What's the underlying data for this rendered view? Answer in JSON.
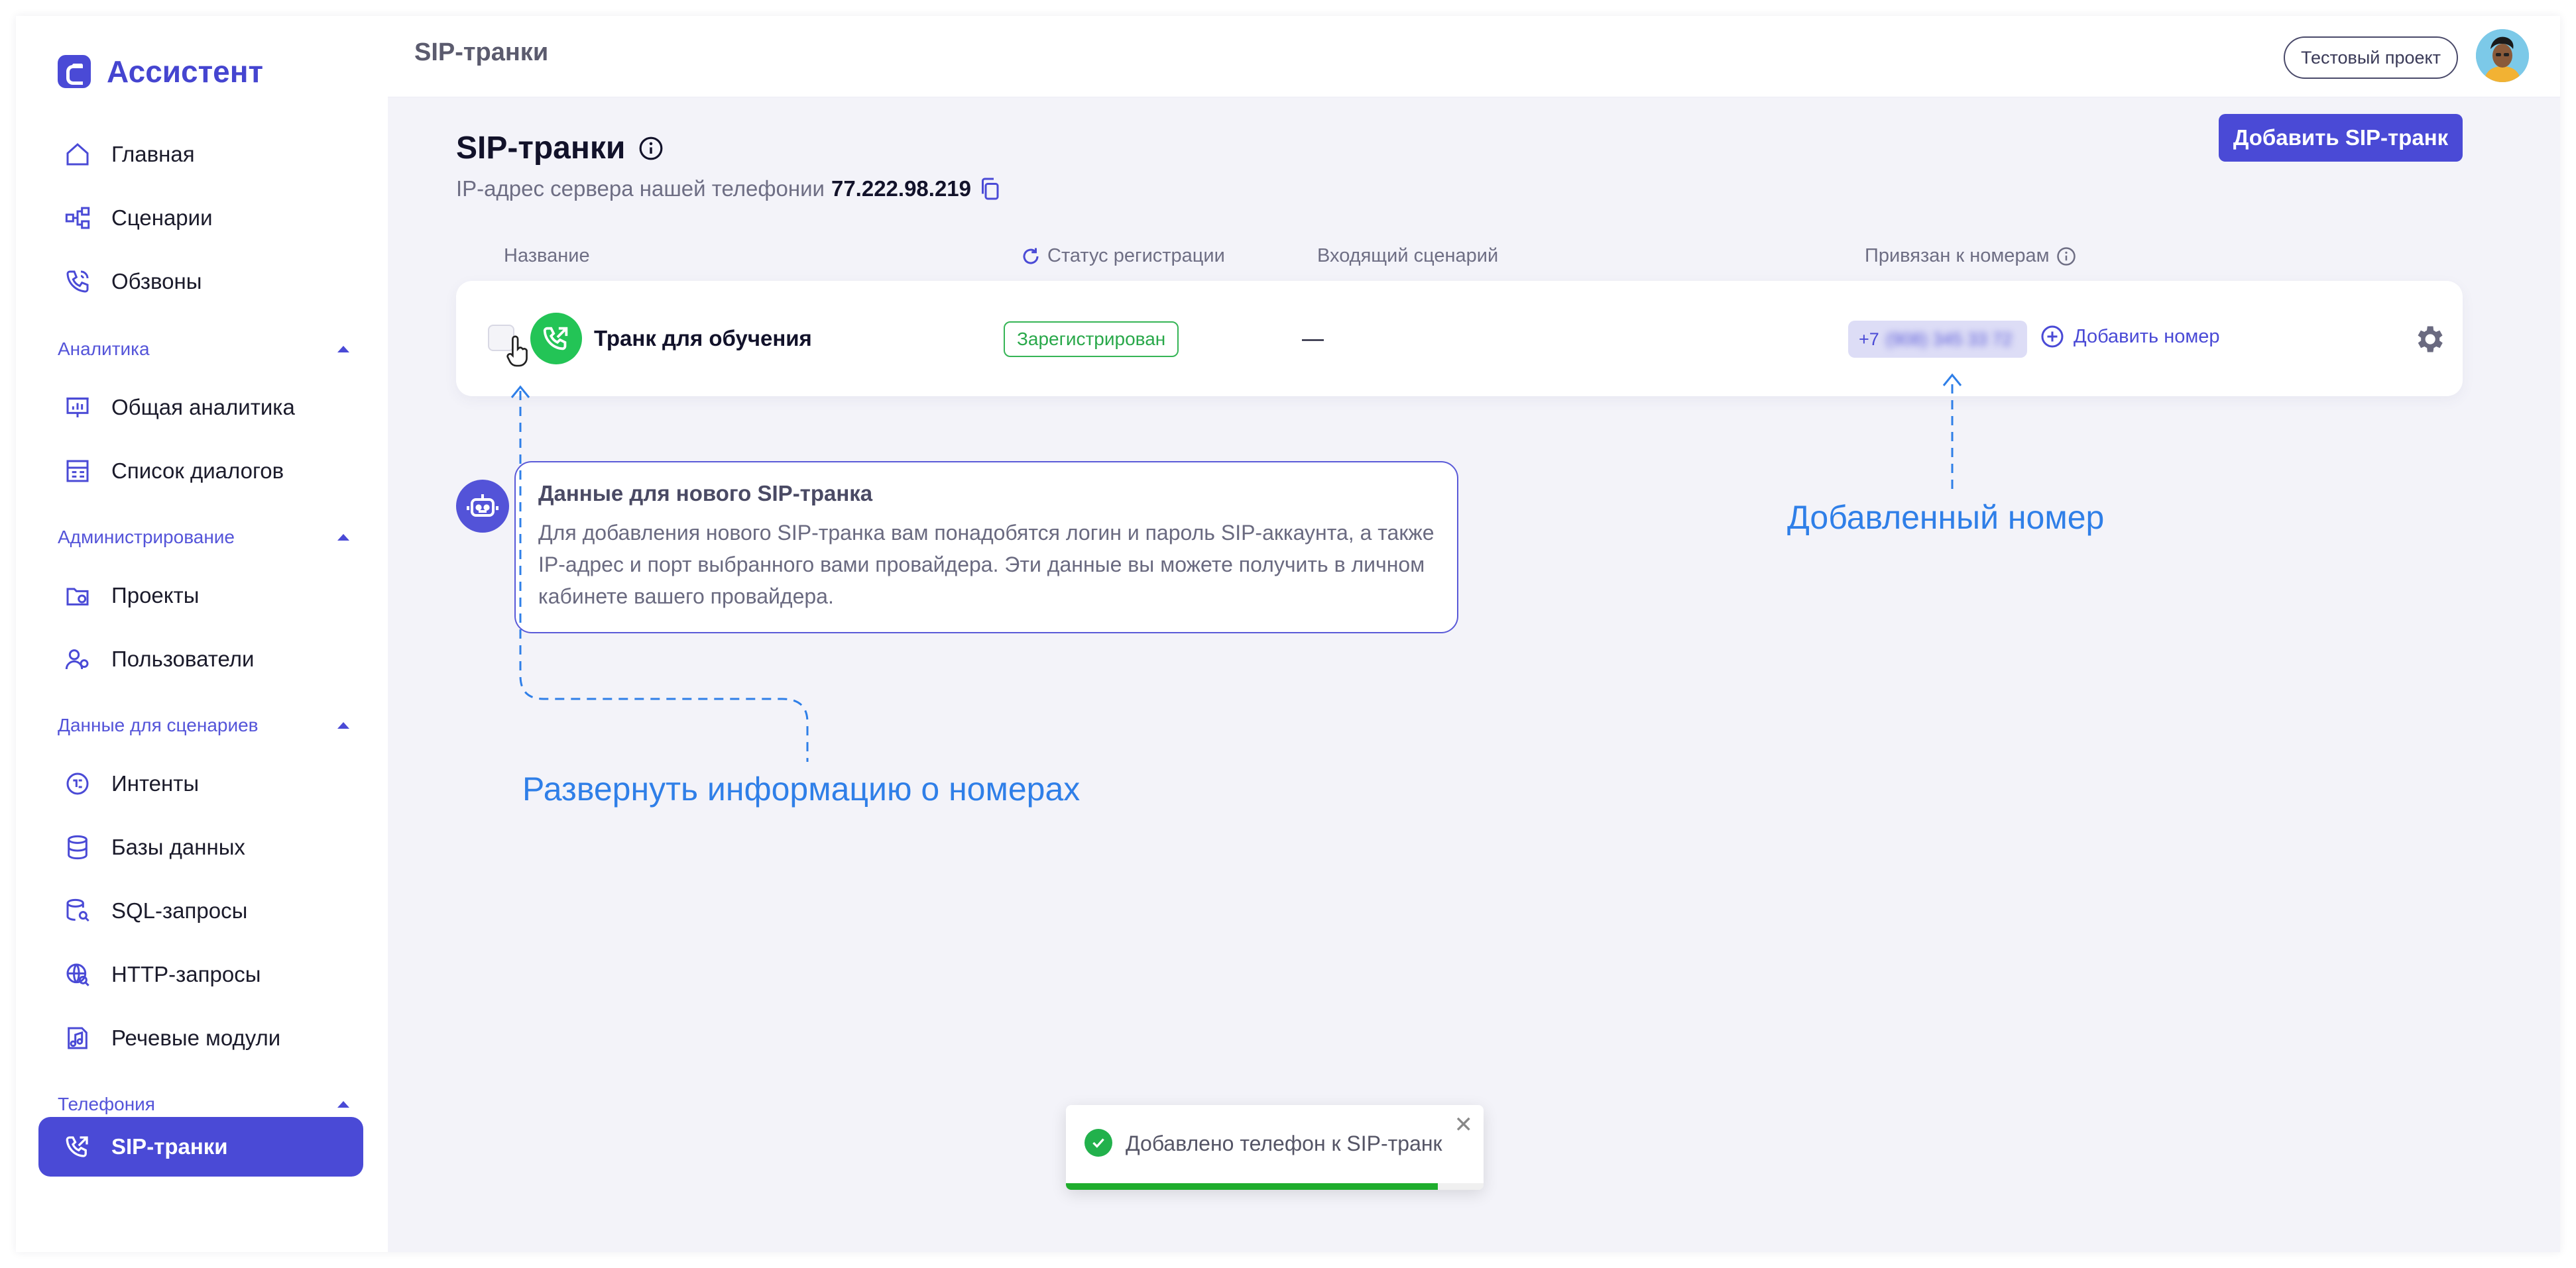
{
  "brand": {
    "name": "Ассистент"
  },
  "sidebar": {
    "items_top": [
      {
        "label": "Главная",
        "icon": "home-icon"
      },
      {
        "label": "Сценарии",
        "icon": "scenarios-icon"
      },
      {
        "label": "Обзвоны",
        "icon": "calls-icon"
      }
    ],
    "groups": [
      {
        "label": "Аналитика",
        "items": [
          {
            "label": "Общая аналитика",
            "icon": "analytics-icon"
          },
          {
            "label": "Список диалогов",
            "icon": "dialogs-icon"
          }
        ]
      },
      {
        "label": "Администрирование",
        "items": [
          {
            "label": "Проекты",
            "icon": "projects-icon"
          },
          {
            "label": "Пользователи",
            "icon": "users-icon"
          }
        ]
      },
      {
        "label": "Данные для сценариев",
        "items": [
          {
            "label": "Интенты",
            "icon": "intents-icon"
          },
          {
            "label": "Базы данных",
            "icon": "database-icon"
          },
          {
            "label": "SQL-запросы",
            "icon": "sql-icon"
          },
          {
            "label": "HTTP-запросы",
            "icon": "http-icon"
          },
          {
            "label": "Речевые модули",
            "icon": "speech-icon"
          }
        ]
      },
      {
        "label": "Телефония",
        "items": [
          {
            "label": "SIP-транки",
            "icon": "sip-icon",
            "active": true
          }
        ]
      }
    ]
  },
  "header": {
    "title": "SIP-транки",
    "project": "Тестовый проект"
  },
  "page": {
    "title": "SIP-транки",
    "ip_label": "IP-адрес сервера нашей телефонии",
    "ip_value": "77.222.98.219",
    "add_button": "Добавить SIP-транк"
  },
  "table": {
    "columns": {
      "name": "Название",
      "status": "Статус регистрации",
      "scenario": "Входящий сценарий",
      "numbers": "Привязан к номерам"
    },
    "row": {
      "name": "Транк для обучения",
      "status": "Зарегистрирован",
      "scenario": "—",
      "phone_prefix": "+7",
      "phone_hidden": "(908) 345 33 72",
      "add_number": "Добавить номер"
    }
  },
  "hint": {
    "title": "Данные для нового SIP-транка",
    "text": "Для добавления нового SIP-транка вам понадобятся логин и пароль SIP-аккаунта, а также IP-адрес и порт выбранного вами провайдера. Эти данные вы можете получить в личном кабинете вашего провайдера."
  },
  "annotations": {
    "added_number": "Добавленный номер",
    "expand_info": "Развернуть информацию о номерах"
  },
  "toast": {
    "message": "Добавлено телефон к SIP-транк",
    "progress": 0.89
  },
  "colors": {
    "accent": "#4a4ad6",
    "success": "#23c456",
    "annotation": "#2f7fe8"
  }
}
